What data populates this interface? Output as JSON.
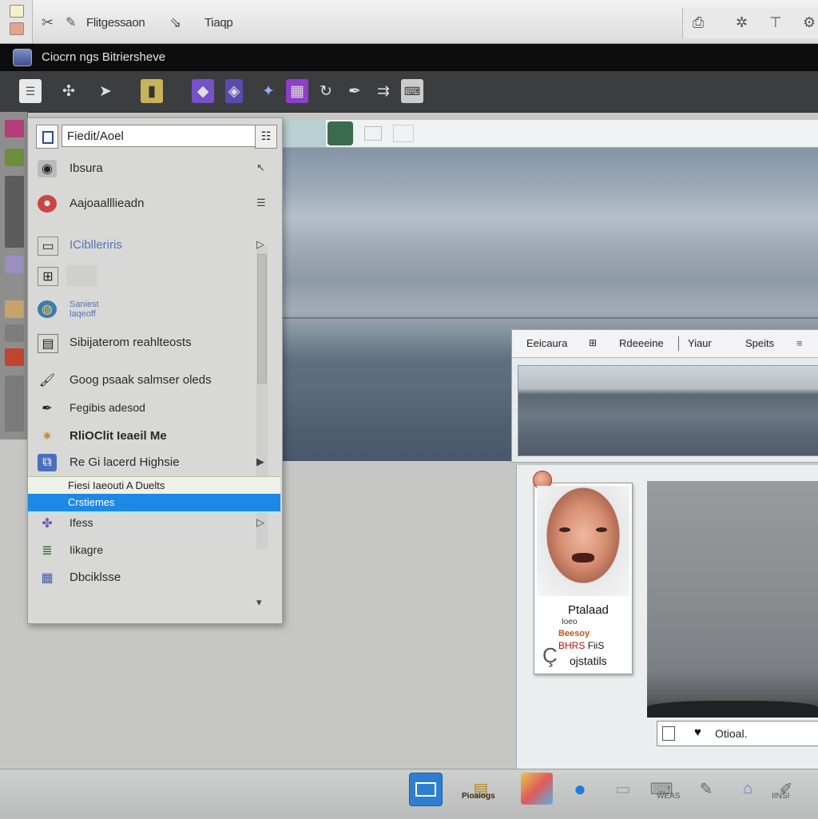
{
  "menubar": {
    "items": [
      "Flitgessaon",
      "Tiaqp"
    ]
  },
  "titlebar": {
    "title": "Ciocrn ngs Bitriersheve"
  },
  "dropdown": {
    "search_value": "Fiedit/Aoel",
    "items": [
      {
        "label": "Ibsura",
        "icon": "camera-icon"
      },
      {
        "label": "Aajoaalllieadn",
        "icon": "mask-icon"
      },
      {
        "label": "ICiblleriris",
        "icon": "folder-icon"
      },
      {
        "label": "",
        "icon": "grid-icon"
      },
      {
        "label": "Saniest\nlaqeoff",
        "icon": "globe-icon"
      },
      {
        "label": "Sibijaterom reahlteosts",
        "icon": "frame-icon"
      },
      {
        "label": "Goog psaak salmser oleds",
        "icon": "brush-icon"
      },
      {
        "label": "Fegibis adesod",
        "icon": "pen-icon"
      },
      {
        "label": "RliOClit Ieaeil Me",
        "icon": "star-icon"
      },
      {
        "label": "Re Gi lacerd Highsie",
        "icon": "layers-icon"
      },
      {
        "label": "Fiesi Iaeouti A Duelts",
        "icon": ""
      },
      {
        "label": "Crstiemes",
        "icon": ""
      },
      {
        "label": "Ifess",
        "icon": "hat-icon"
      },
      {
        "label": "Iikagre",
        "icon": "list-icon"
      },
      {
        "label": "Dbciklsse",
        "icon": "calendar-icon"
      }
    ]
  },
  "docwindow": {
    "tabs": [
      "Eeicaura",
      "Rdeeeine",
      "Yiaur",
      "Speits"
    ]
  },
  "card": {
    "line1": "Ptalaad",
    "line2": "Ioeo",
    "line3": "Beesoy",
    "line4_red": "BHRS",
    "line4": "FiiS",
    "line5": "ojstatils"
  },
  "inputbar": {
    "value": "Otioal."
  },
  "dock": {
    "labels": [
      "Pioaiogs",
      "WEAS",
      "IINSI"
    ]
  },
  "colors": {
    "highlight": "#1e88e5",
    "toolbar": "#3c3d3f",
    "titlestrip": "#0c0c0c"
  }
}
